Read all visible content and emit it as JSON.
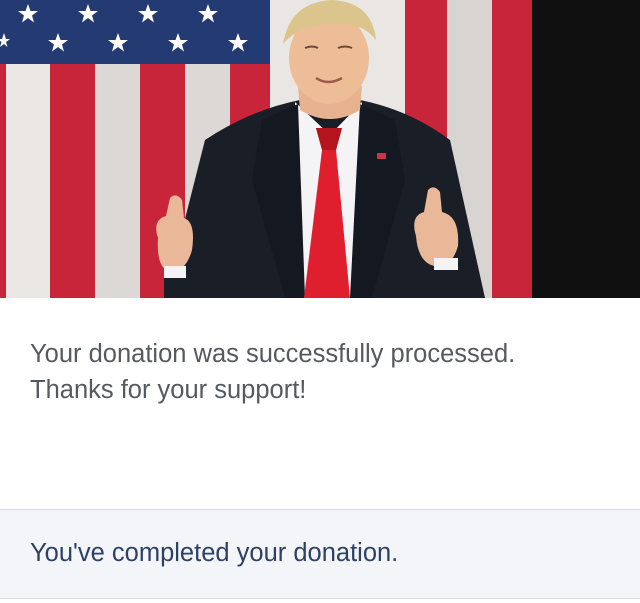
{
  "hero": {
    "image": "thumbs-up-man-in-front-of-american-flag"
  },
  "message": {
    "line1": "Your donation was successfully processed.",
    "line2": "Thanks for your support!"
  },
  "status": {
    "text": "You've completed your donation."
  },
  "colors": {
    "message_text": "#555a60",
    "status_text": "#2d4066",
    "status_bg": "#f3f5f9",
    "status_border": "#d3dbe8",
    "flag_blue": "#243a73",
    "flag_red": "#c8243a",
    "tie_red": "#e01f2e",
    "suit": "#1a1e27"
  }
}
